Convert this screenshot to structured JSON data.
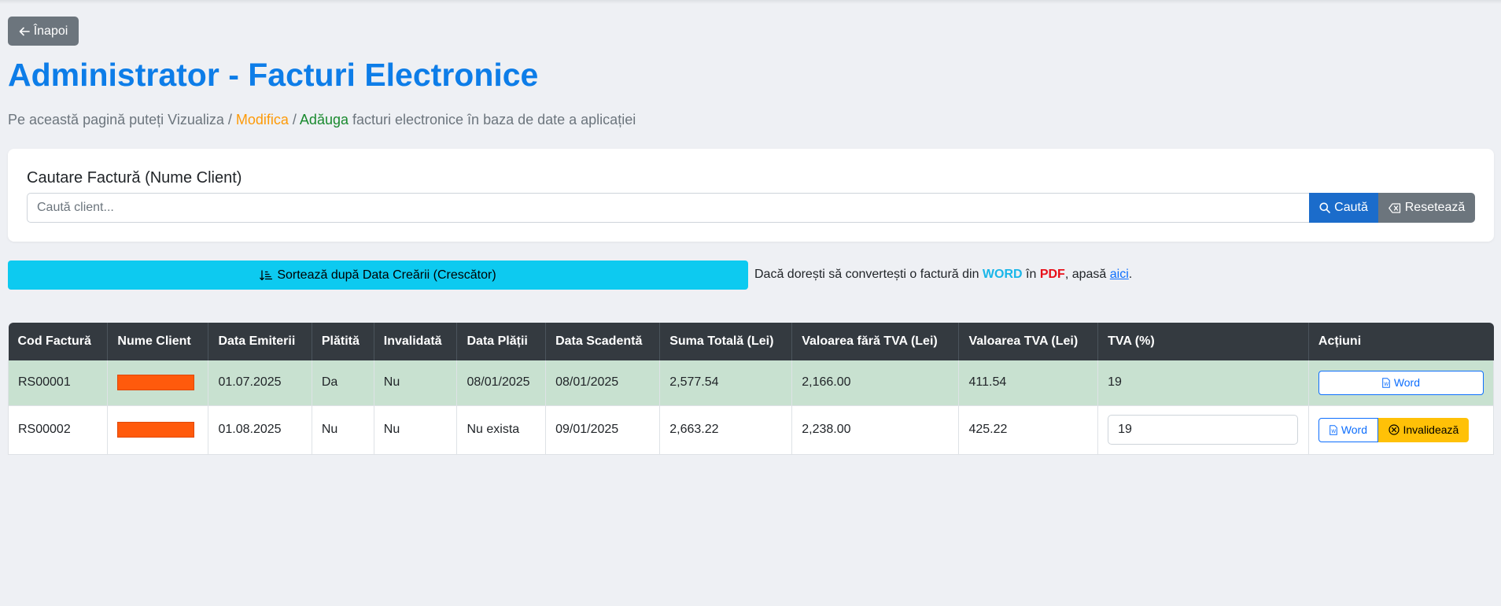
{
  "header": {
    "back_label": "Înapoi",
    "title": "Administrator - Facturi Electronice",
    "subtitle": {
      "prefix": "Pe această pagină puteți Vizualiza / ",
      "modify": "Modifica",
      "sep": " / ",
      "add": "Adăuga",
      "suffix": " facturi electronice în baza de date a aplicației"
    }
  },
  "search": {
    "label": "Cautare Factură (Nume Client)",
    "placeholder": "Caută client...",
    "value": "",
    "search_label": "Caută",
    "reset_label": "Resetează"
  },
  "sort": {
    "label": "Sortează după Data Creării (Crescător)"
  },
  "convert_note": {
    "prefix": "Dacă dorești să convertești o factură din ",
    "word": "WORD",
    "mid": " în ",
    "pdf": "PDF",
    "suffix1": ", apasă ",
    "link": "aici",
    "suffix2": "."
  },
  "table": {
    "columns": [
      "Cod Factură",
      "Nume Client",
      "Data Emiterii",
      "Plătită",
      "Invalidată",
      "Data Plății",
      "Data Scadentă",
      "Suma Totală (Lei)",
      "Valoarea fără TVA (Lei)",
      "Valoarea TVA (Lei)",
      "TVA (%)",
      "Acțiuni"
    ],
    "rows": [
      {
        "cod": "RS00001",
        "data_emiterii": "01.07.2025",
        "platita": "Da",
        "invalidata": "Nu",
        "data_platii": "08/01/2025",
        "data_scadenta": "08/01/2025",
        "suma_totala": "2,577.54",
        "valoare_fara_tva": "2,166.00",
        "valoare_tva": "411.54",
        "tva": "19",
        "word_label": "Word"
      },
      {
        "cod": "RS00002",
        "data_emiterii": "01.08.2025",
        "platita": "Nu",
        "invalidata": "Nu",
        "data_platii": "Nu exista",
        "data_scadenta": "09/01/2025",
        "suma_totala": "2,663.22",
        "valoare_fara_tva": "2,238.00",
        "valoare_tva": "425.22",
        "tva": "19",
        "word_label": "Word",
        "invalidate_label": "Invalidează"
      }
    ]
  },
  "colors": {
    "title": "#0d7de8",
    "paid_row": "#c8e1d0",
    "sort_button": "#0dcaf0",
    "invalidate_button": "#ffc107",
    "redaction": "#ff5a0c"
  }
}
